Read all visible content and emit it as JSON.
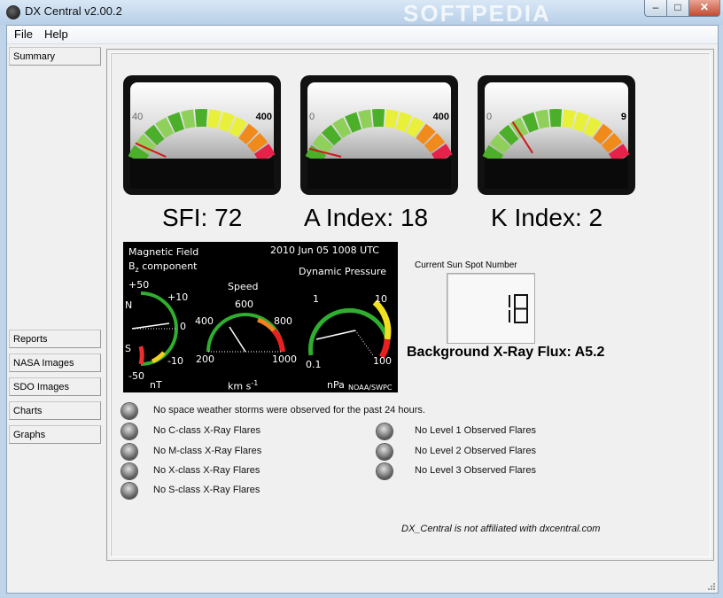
{
  "window": {
    "title": "DX Central  v2.00.2",
    "watermark": "SOFTPEDIA",
    "buttons": {
      "minimize": "–",
      "maximize": "□",
      "close": "✕"
    }
  },
  "menu": {
    "file": "File",
    "help": "Help"
  },
  "sidebar": {
    "items": [
      {
        "label": "Summary"
      },
      {
        "label": "Reports"
      },
      {
        "label": "NASA Images"
      },
      {
        "label": "SDO Images"
      },
      {
        "label": "Charts"
      },
      {
        "label": "Graphs"
      }
    ]
  },
  "gauges": [
    {
      "min_label": "40",
      "max_label": "400",
      "value_fraction": 0.08,
      "caption": "SFI: 72"
    },
    {
      "min_label": "0",
      "max_label": "400",
      "value_fraction": 0.045,
      "caption": "A Index: 18"
    },
    {
      "min_label": "0",
      "max_label": "9",
      "value_fraction": 0.25,
      "caption": "K Index: 2"
    }
  ],
  "space_weather": {
    "title_line1": "Magnetic Field",
    "title_line2_b": "B",
    "title_line2_sub": "z",
    "title_line2_rest": "component",
    "timestamp": "2010 Jun 05 1008 UTC",
    "dynamic_pressure": "Dynamic Pressure",
    "speed": "Speed",
    "mag_ticks": {
      "p50": "+50",
      "p10": "+10",
      "n": "N",
      "zero": "0",
      "s": "S",
      "m10": "-10",
      "m50": "-50",
      "unit": "nT"
    },
    "speed_ticks": {
      "t400": "400",
      "t600": "600",
      "t800": "800",
      "t200": "200",
      "t1000": "1000",
      "unit": "km s",
      "unit_exp": "-1"
    },
    "pressure_ticks": {
      "t1": "1",
      "t10": "10",
      "t01": "0.1",
      "t100": "100",
      "unit": "nPa",
      "credit": "NOAA/SWPC"
    }
  },
  "sunspot": {
    "label": "Current Sun Spot Number",
    "value": "18"
  },
  "xray": {
    "label": "Background X-Ray Flux: A5.2"
  },
  "status": {
    "storms": "No space weather storms were observed for the past 24 hours.",
    "left": [
      "No C-class X-Ray Flares",
      "No M-class X-Ray Flares",
      "No X-class X-Ray Flares",
      "No S-class X-Ray Flares"
    ],
    "right": [
      "No Level 1 Observed Flares",
      "No Level 2 Observed Flares",
      "No Level 3 Observed Flares"
    ]
  },
  "footnote": "DX_Central is not affiliated with dxcentral.com",
  "colors": {
    "green": "#4caf2a",
    "lightgreen": "#8fd05a",
    "yellow": "#e8f03a",
    "orange": "#f08a1a",
    "red": "#e8214a",
    "needle": "#d01818"
  }
}
